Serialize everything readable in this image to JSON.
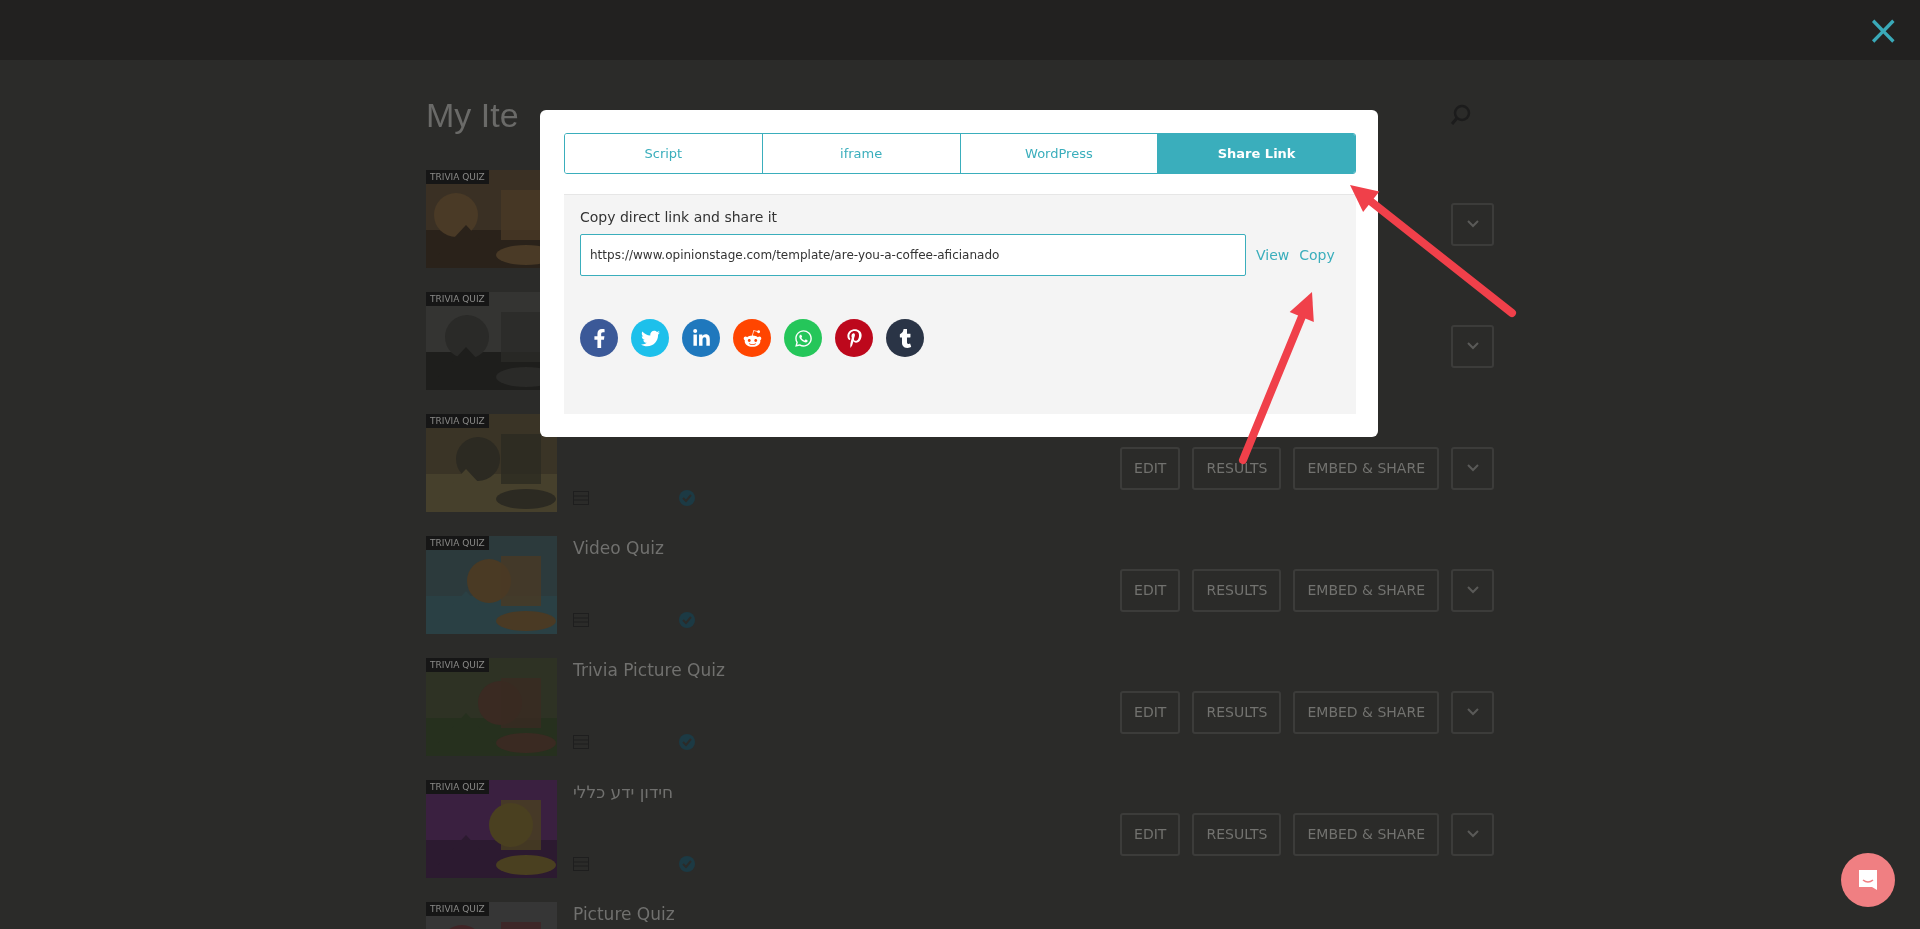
{
  "page": {
    "heading": "My Ite",
    "close": "×"
  },
  "items": [
    {
      "badge": "TRIVIA QUIZ",
      "covered": true
    },
    {
      "badge": "TRIVIA QUIZ",
      "covered": true
    },
    {
      "badge": "TRIVIA QUIZ",
      "covered": false,
      "buttons": [
        "EDIT",
        "RESULTS",
        "EMBED & SHARE"
      ]
    },
    {
      "badge": "TRIVIA QUIZ",
      "title": "Video Quiz",
      "covered": false,
      "buttons": [
        "EDIT",
        "RESULTS",
        "EMBED & SHARE"
      ]
    },
    {
      "badge": "TRIVIA QUIZ",
      "title": "Trivia Picture Quiz",
      "covered": false,
      "buttons": [
        "EDIT",
        "RESULTS",
        "EMBED & SHARE"
      ]
    },
    {
      "badge": "TRIVIA QUIZ",
      "title": "חידון ידע כללי",
      "covered": false,
      "buttons": [
        "EDIT",
        "RESULTS",
        "EMBED & SHARE"
      ]
    },
    {
      "badge": "TRIVIA QUIZ",
      "title": "Picture Quiz"
    }
  ],
  "dialog": {
    "tabs": [
      {
        "label": "Script",
        "selected": false
      },
      {
        "label": "iframe",
        "selected": false
      },
      {
        "label": "WordPress",
        "selected": false
      },
      {
        "label": "Share Link",
        "selected": true
      }
    ],
    "label": "Copy direct link and share it",
    "link": "https://www.opinionstage.com/template/are-you-a-coffee-aficianado",
    "actions": [
      "View",
      "Copy"
    ],
    "share": [
      {
        "kind": "facebook",
        "color": "#3b5998"
      },
      {
        "kind": "twitter",
        "color": "#1dc0eb"
      },
      {
        "kind": "linkedin",
        "color": "#1f78bd"
      },
      {
        "kind": "reddit",
        "color": "#ff4500"
      },
      {
        "kind": "whatsapp",
        "color": "#25c65a"
      },
      {
        "kind": "pinterest",
        "color": "#bd081c"
      },
      {
        "kind": "tumblr",
        "color": "#2a3446"
      }
    ]
  }
}
